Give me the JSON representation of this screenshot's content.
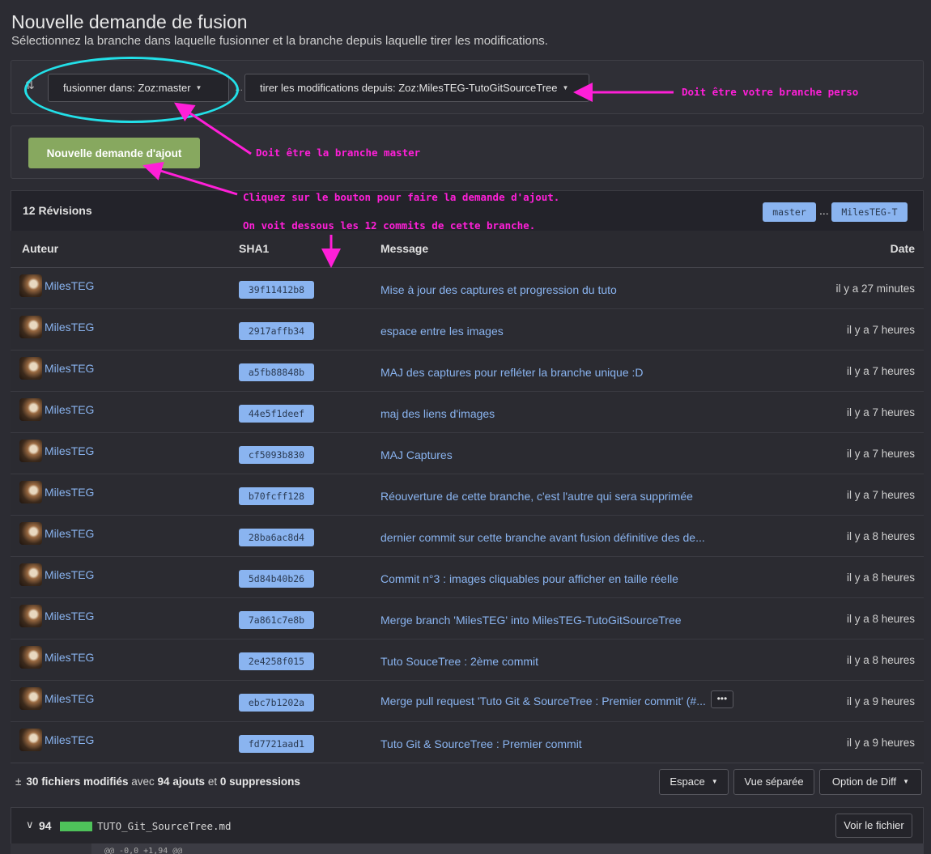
{
  "page": {
    "title": "Nouvelle demande de fusion",
    "subtitle": "Sélectionnez la branche dans laquelle fusionner et la branche depuis laquelle tirer les modifications."
  },
  "branches": {
    "base_label": "fusionner dans: Zoz:master",
    "head_label": "tirer les modifications depuis: Zoz:MilesTEG-TutoGitSourceTree",
    "separator": "..."
  },
  "actions": {
    "create_label": "Nouvelle demande d'ajout"
  },
  "commits": {
    "title": "12 Révisions",
    "base_ref": "master",
    "ref_separator": "...",
    "head_ref": "MilesTEG-T",
    "columns": {
      "author": "Auteur",
      "sha": "SHA1",
      "message": "Message",
      "date": "Date"
    },
    "rows": [
      {
        "author": "MilesTEG",
        "sha": "39f11412b8",
        "message": "Mise à jour des captures et progression du tuto",
        "date": "il y a 27 minutes"
      },
      {
        "author": "MilesTEG",
        "sha": "2917affb34",
        "message": "espace entre les images",
        "date": "il y a 7 heures"
      },
      {
        "author": "MilesTEG",
        "sha": "a5fb88848b",
        "message": "MAJ des captures pour refléter la branche unique :D",
        "date": "il y a 7 heures"
      },
      {
        "author": "MilesTEG",
        "sha": "44e5f1deef",
        "message": "maj des liens d'images",
        "date": "il y a 7 heures"
      },
      {
        "author": "MilesTEG",
        "sha": "cf5093b830",
        "message": "MAJ Captures",
        "date": "il y a 7 heures"
      },
      {
        "author": "MilesTEG",
        "sha": "b70fcff128",
        "message": "Réouverture de cette branche, c'est l'autre qui sera supprimée",
        "date": "il y a 7 heures"
      },
      {
        "author": "MilesTEG",
        "sha": "28ba6ac8d4",
        "message": "dernier commit sur cette branche avant fusion définitive des de...",
        "date": "il y a 8 heures"
      },
      {
        "author": "MilesTEG",
        "sha": "5d84b40b26",
        "message": "Commit n°3 : images cliquables pour afficher en taille réelle",
        "date": "il y a 8 heures"
      },
      {
        "author": "MilesTEG",
        "sha": "7a861c7e8b",
        "message": "Merge branch 'MilesTEG' into MilesTEG-TutoGitSourceTree",
        "date": "il y a 8 heures"
      },
      {
        "author": "MilesTEG",
        "sha": "2e4258f015",
        "message": "Tuto SouceTree : 2ème commit",
        "date": "il y a 8 heures"
      },
      {
        "author": "MilesTEG",
        "sha": "ebc7b1202a",
        "message": "Merge pull request 'Tuto Git & SourceTree : Premier commit' (#...",
        "date": "il y a 9 heures",
        "has_more": true
      },
      {
        "author": "MilesTEG",
        "sha": "fd7721aad1",
        "message": "Tuto Git & SourceTree : Premier commit",
        "date": "il y a 9 heures"
      }
    ],
    "more_label": "•••"
  },
  "diff": {
    "files_changed": "30 fichiers modifiés",
    "with_text": "avec",
    "additions": "94 ajouts",
    "and_text": "et",
    "deletions": "0 suppressions",
    "space_label": "Espace",
    "split_label": "Vue séparée",
    "option_label": "Option de Diff",
    "file": {
      "count": "94",
      "name": "TUTO_Git_SourceTree.md",
      "view_label": "Voir le fichier",
      "hunk": "@@ -0,0 +1,94 @@"
    }
  },
  "annotations": {
    "perso": "Doit être votre branche perso",
    "master": "Doit être la branche master",
    "click": "Cliquez sur le bouton pour faire la demande d'ajout.",
    "commits": "On voit dessous les 12 commits de cette branche."
  },
  "colors": {
    "accent_link": "#8ab4f0",
    "primary_button": "#87a85f",
    "annotation": "#ff1fd8",
    "highlight": "#22e0e8",
    "additions_bar": "#4ec25a"
  },
  "icons": [
    "swap-icon",
    "caret-down-icon",
    "avatar",
    "ellipsis-icon",
    "plus-minus-icon",
    "chevron-down-icon"
  ]
}
